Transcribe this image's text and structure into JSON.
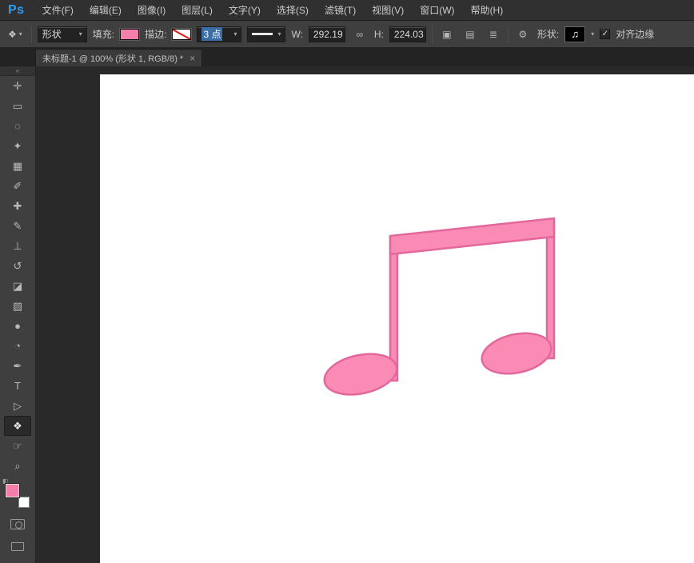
{
  "app": {
    "logo_text": "Ps"
  },
  "colors": {
    "logo_blue": "#2f9bf2",
    "accent_pink": "#f47fab",
    "selection_blue": "#3b6ea5",
    "note_fill": "#f98bb4",
    "note_stroke": "#e2679c"
  },
  "menubar": {
    "items": [
      "文件(F)",
      "编辑(E)",
      "图像(I)",
      "图层(L)",
      "文字(Y)",
      "选择(S)",
      "滤镜(T)",
      "视图(V)",
      "窗口(W)",
      "帮助(H)"
    ]
  },
  "options": {
    "tool_preset_glyph": "❖",
    "dropdown_glyph": "▾",
    "mode_value": "形状",
    "fill_label": "填充:",
    "stroke_label": "描边:",
    "stroke_width_value": "3 点",
    "w_label": "W:",
    "w_value": "292.19",
    "link_glyph": "∞",
    "h_label": "H:",
    "h_value": "224.03",
    "path_buttons": [
      {
        "name": "path-operations",
        "glyph": "▣"
      },
      {
        "name": "path-alignment",
        "glyph": "▤"
      },
      {
        "name": "path-arrangement",
        "glyph": "≣"
      }
    ],
    "gear_glyph": "⚙",
    "shape_label": "形状:",
    "shape_thumb_glyph": "♫",
    "check_glyph": "✓",
    "align_edges_label": "对齐边缘"
  },
  "tabbar": {
    "title": "未标题-1 @ 100% (形状 1, RGB/8) *",
    "close_glyph": "×"
  },
  "toolbar": {
    "collapse_glyph": "«",
    "swap_glyph": "⇄",
    "mini_default_glyph": "◧",
    "tools": [
      {
        "name": "move-tool",
        "glyph": "✛"
      },
      {
        "name": "rectangular-marquee-tool",
        "glyph": "▭"
      },
      {
        "name": "lasso-tool",
        "glyph": "◌"
      },
      {
        "name": "quick-selection-tool",
        "glyph": "✦"
      },
      {
        "name": "crop-tool",
        "glyph": "▦"
      },
      {
        "name": "eyedropper-tool",
        "glyph": "✐"
      },
      {
        "name": "spot-healing-brush-tool",
        "glyph": "✚"
      },
      {
        "name": "brush-tool",
        "glyph": "✎"
      },
      {
        "name": "clone-stamp-tool",
        "glyph": "⊥"
      },
      {
        "name": "history-brush-tool",
        "glyph": "↺"
      },
      {
        "name": "eraser-tool",
        "glyph": "◪"
      },
      {
        "name": "gradient-tool",
        "glyph": "▨"
      },
      {
        "name": "blur-tool",
        "glyph": "●"
      },
      {
        "name": "dodge-tool",
        "glyph": "◔"
      },
      {
        "name": "pen-tool",
        "glyph": "✒"
      },
      {
        "name": "type-tool",
        "glyph": "T"
      },
      {
        "name": "path-selection-tool",
        "glyph": "▷"
      },
      {
        "name": "custom-shape-tool",
        "glyph": "❖"
      },
      {
        "name": "hand-tool",
        "glyph": "☞"
      },
      {
        "name": "zoom-tool",
        "glyph": "⌕"
      }
    ]
  }
}
